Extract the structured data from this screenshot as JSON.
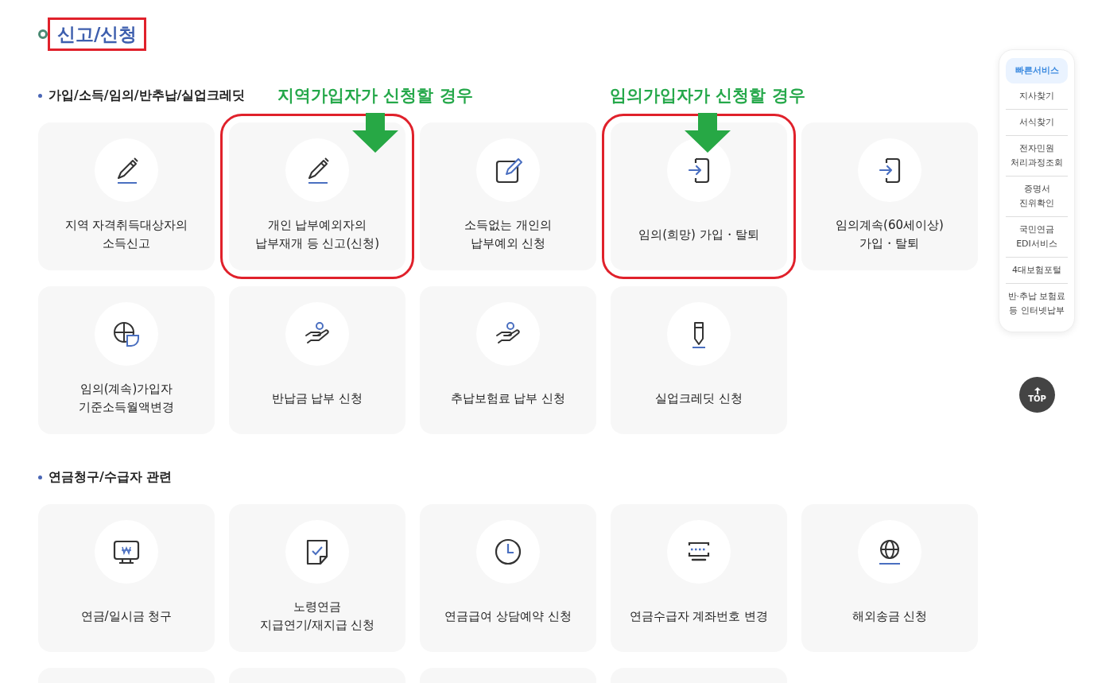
{
  "page_title": {
    "text": "신고/신청",
    "highlight": true
  },
  "sections": [
    {
      "title": "가입/소득/임의/반추납/실업크레딧",
      "items": [
        {
          "kind": "card",
          "label": "지역 자격취득대상자의\n소득신고",
          "highlight": false
        },
        {
          "kind": "card",
          "label": "개인 납부예외자의\n납부재개 등 신고(신청)",
          "highlight": true,
          "callout": "지역가입자가 신청할 경우"
        },
        {
          "kind": "card",
          "label": "소득없는 개인의\n납부예외 신청",
          "highlight": false
        },
        {
          "kind": "card",
          "label": "임의(희망) 가입・탈퇴",
          "highlight": true,
          "callout": "임의가입자가 신청할 경우"
        },
        {
          "kind": "card",
          "label": "임의계속(60세이상)\n가입・탈퇴",
          "highlight": false
        },
        {
          "kind": "card",
          "label": "임의(계속)가입자\n기준소득월액변경",
          "highlight": false
        },
        {
          "kind": "card",
          "label": "반납금 납부 신청",
          "highlight": false
        },
        {
          "kind": "card",
          "label": "추납보험료 납부 신청",
          "highlight": false
        },
        {
          "kind": "card",
          "label": "실업크레딧 신청",
          "highlight": false
        }
      ]
    },
    {
      "title": "연금청구/수급자 관련",
      "items": [
        {
          "kind": "card",
          "label": "연금/일시금 청구",
          "highlight": false
        },
        {
          "kind": "card",
          "label": "노령연금\n지급연기/재지급 신청",
          "highlight": false
        },
        {
          "kind": "card",
          "label": "연금급여 상담예약 신청",
          "highlight": false
        },
        {
          "kind": "card",
          "label": "연금수급자 계좌번호 변경",
          "highlight": false
        },
        {
          "kind": "card",
          "label": "해외송금 신청",
          "highlight": false
        },
        {
          "kind": "cut-off"
        },
        {
          "kind": "cut-off"
        },
        {
          "kind": "cut-off"
        },
        {
          "kind": "cut-off"
        }
      ]
    }
  ],
  "quick_menu": {
    "items": [
      {
        "label": "빠른서비스",
        "selected": true
      },
      {
        "label": "지사찾기",
        "selected": false
      },
      {
        "label": "서식찾기",
        "selected": false
      },
      {
        "label": "전자민원\n처리과정조회",
        "selected": false
      },
      {
        "label": "증명서\n진위확인",
        "selected": false
      },
      {
        "label": "국민연금\nEDI서비스",
        "selected": false
      },
      {
        "label": "4대보험포털",
        "selected": false
      },
      {
        "label": "반·추납 보험료\n등 인터넷납부",
        "selected": false
      }
    ],
    "top_button": "TOP"
  }
}
